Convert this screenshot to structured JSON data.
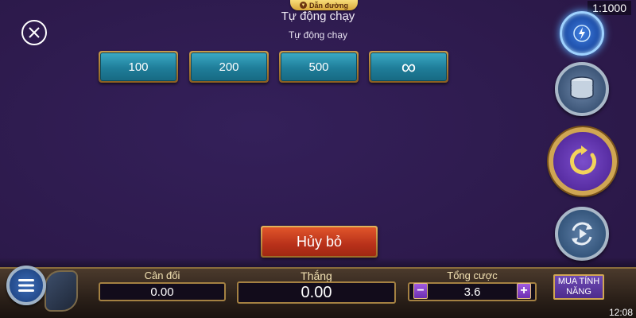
{
  "header": {
    "guide_tab": "Dẫn đường",
    "title": "Tự động chạy",
    "subtitle": "Tự động chạy",
    "rate": "1:1000"
  },
  "autoplay": {
    "options": [
      "100",
      "200",
      "500",
      "∞"
    ],
    "cancel_label": "Hủy bỏ"
  },
  "bottom_bar": {
    "balance_label": "Cân đối",
    "balance_value": "0.00",
    "win_label": "Thắng",
    "win_value": "0.00",
    "total_bet_label": "Tổng cược",
    "total_bet_value": "3.6",
    "minus": "−",
    "plus": "+",
    "buy_feature": "MUA TÍNH NĂNG"
  },
  "status": {
    "time": "12:08"
  },
  "icons": {
    "close": "close-icon",
    "turbo": "lightning-icon",
    "bet": "coin-stack-icon",
    "auto": "autoplay-icon",
    "spin": "refresh-play-icon",
    "menu": "hamburger-icon"
  },
  "colors": {
    "background": "#2f1a4f",
    "option_teal": "#1f7d99",
    "cancel_red": "#b8311a",
    "gold_border": "#c99a4a"
  }
}
